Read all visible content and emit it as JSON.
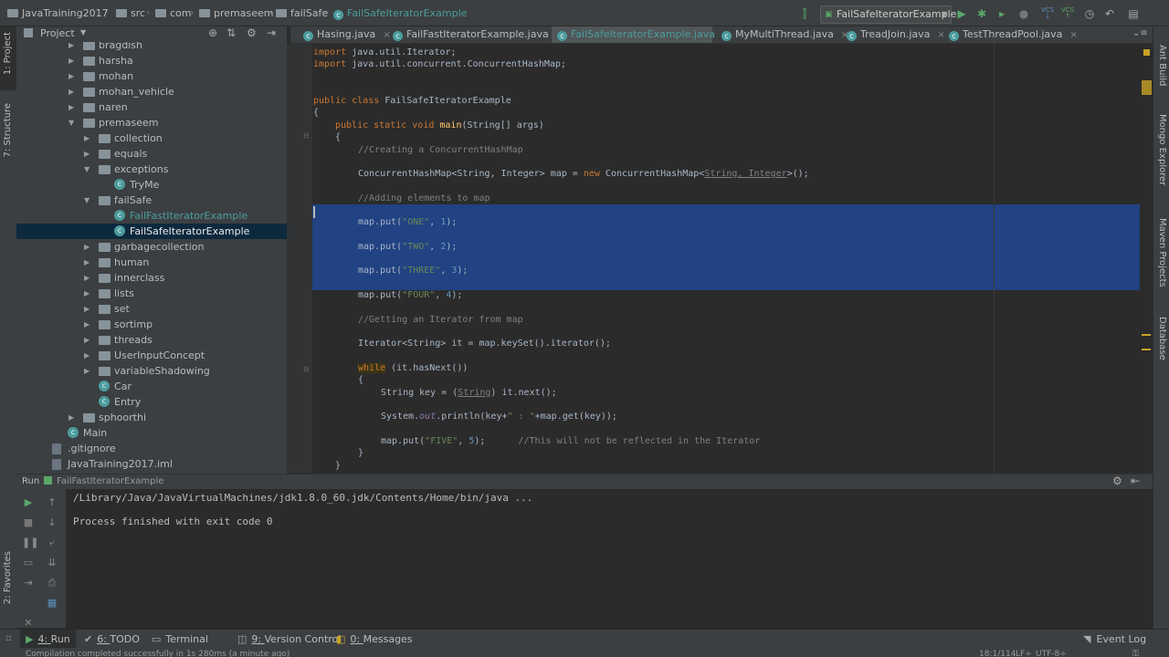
{
  "navbar": {
    "crumbs": [
      "JavaTraining2017",
      "src",
      "com",
      "premaseem",
      "failSafe",
      "FailSafeIteratorExample"
    ],
    "run_config": "FailSafeIteratorExample"
  },
  "tool_stripes": {
    "left": [
      "1: Project",
      "7: Structure",
      "2: Favorites"
    ],
    "right": [
      "Ant Build",
      "Mongo Explorer",
      "Maven Projects",
      "Database"
    ]
  },
  "project": {
    "header": "Project",
    "tree": [
      {
        "label": "bragdish",
        "kind": "folder",
        "level": 3,
        "arrow": "right"
      },
      {
        "label": "harsha",
        "kind": "folder",
        "level": 3,
        "arrow": "right"
      },
      {
        "label": "mohan",
        "kind": "folder",
        "level": 3,
        "arrow": "right"
      },
      {
        "label": "mohan_vehicle",
        "kind": "folder",
        "level": 3,
        "arrow": "right"
      },
      {
        "label": "naren",
        "kind": "folder",
        "level": 3,
        "arrow": "right"
      },
      {
        "label": "premaseem",
        "kind": "folder",
        "level": 3,
        "arrow": "down"
      },
      {
        "label": "collection",
        "kind": "folder",
        "level": 4,
        "arrow": "right"
      },
      {
        "label": "equals",
        "kind": "folder",
        "level": 4,
        "arrow": "right"
      },
      {
        "label": "exceptions",
        "kind": "folder",
        "level": 4,
        "arrow": "down"
      },
      {
        "label": "TryMe",
        "kind": "class",
        "level": 5,
        "arrow": ""
      },
      {
        "label": "failSafe",
        "kind": "folder",
        "level": 4,
        "arrow": "down"
      },
      {
        "label": "FailFastIteratorExample",
        "kind": "class",
        "level": 5,
        "arrow": "",
        "highlight": true
      },
      {
        "label": "FailSafeIteratorExample",
        "kind": "class",
        "level": 5,
        "arrow": "",
        "selected": true
      },
      {
        "label": "garbagecollection",
        "kind": "folder",
        "level": 4,
        "arrow": "right"
      },
      {
        "label": "human",
        "kind": "folder",
        "level": 4,
        "arrow": "right"
      },
      {
        "label": "innerclass",
        "kind": "folder",
        "level": 4,
        "arrow": "right"
      },
      {
        "label": "lists",
        "kind": "folder",
        "level": 4,
        "arrow": "right"
      },
      {
        "label": "set",
        "kind": "folder",
        "level": 4,
        "arrow": "right"
      },
      {
        "label": "sortimp",
        "kind": "folder",
        "level": 4,
        "arrow": "right"
      },
      {
        "label": "threads",
        "kind": "folder",
        "level": 4,
        "arrow": "right"
      },
      {
        "label": "UserInputConcept",
        "kind": "folder",
        "level": 4,
        "arrow": "right"
      },
      {
        "label": "variableShadowing",
        "kind": "folder",
        "level": 4,
        "arrow": "right"
      },
      {
        "label": "Car",
        "kind": "class",
        "level": 4,
        "arrow": ""
      },
      {
        "label": "Entry",
        "kind": "class",
        "level": 4,
        "arrow": ""
      },
      {
        "label": "sphoorthi",
        "kind": "folder",
        "level": 3,
        "arrow": "right"
      },
      {
        "label": "Main",
        "kind": "class",
        "level": 2,
        "arrow": ""
      },
      {
        "label": ".gitignore",
        "kind": "file",
        "level": 1,
        "arrow": ""
      },
      {
        "label": "JavaTraining2017.iml",
        "kind": "file",
        "level": 1,
        "arrow": ""
      }
    ]
  },
  "tabs": [
    {
      "label": "Hasing.java",
      "active": false
    },
    {
      "label": "FailFastIteratorExample.java",
      "active": false
    },
    {
      "label": "FailSafeIteratorExample.java",
      "active": true
    },
    {
      "label": "MyMultiThread.java",
      "active": false
    },
    {
      "label": "TreadJoin.java",
      "active": false
    },
    {
      "label": "TestThreadPool.java",
      "active": false
    }
  ],
  "code": {
    "import1_kw": "import",
    "import1": " java.util.Iterator;",
    "import2_kw": "import",
    "import2": " java.util.concurrent.ConcurrentHashMap;",
    "class_kw": "public class",
    "class_name": " FailSafeIteratorExample",
    "brace_open": "{",
    "main_kw": "public static void",
    "main_name": " main",
    "main_args": "(String[] args)",
    "inner_brace": "{",
    "comment_create": "//Creating a ConcurrentHashMap",
    "map_decl_a": "ConcurrentHashMap<String, Integer> map = ",
    "map_decl_new": "new",
    "map_decl_b": " ConcurrentHashMap<",
    "map_decl_c": "String, Integer",
    "map_decl_d": ">();",
    "comment_add": "//Adding elements to map",
    "puts": [
      {
        "pre": "map.put(",
        "key": "\"ONE\"",
        "mid": ", ",
        "val": "1",
        "post": ");"
      },
      {
        "pre": "map.put(",
        "key": "\"TWO\"",
        "mid": ", ",
        "val": "2",
        "post": ");"
      },
      {
        "pre": "map.put(",
        "key": "\"THREE\"",
        "mid": ", ",
        "val": "3",
        "post": ");"
      },
      {
        "pre": "map.put(",
        "key": "\"FOUR\"",
        "mid": ", ",
        "val": "4",
        "post": ");"
      }
    ],
    "comment_get": "//Getting an Iterator from map",
    "iter_decl": "Iterator<String> it = map.keySet().iterator();",
    "while_kw": "while",
    "while_cond": " (it.hasNext())",
    "loop_brace": "{",
    "key_a": "String key = (",
    "key_cast": "String",
    "key_b": ") it.next();",
    "print_a": "System.",
    "print_out": "out",
    "print_b": ".println(key+",
    "print_str": "\" : \"",
    "print_c": "+map.get(key));",
    "five_pre": "map.put(",
    "five_key": "\"FIVE\"",
    "five_mid": ", ",
    "five_val": "5",
    "five_post": ");",
    "five_comment": "//This will not be reflected in the Iterator",
    "loop_close": "}",
    "method_close": "}"
  },
  "run": {
    "header_label": "Run",
    "config": "FailFastIteratorExample",
    "console_cmd": "/Library/Java/JavaVirtualMachines/jdk1.8.0_60.jdk/Contents/Home/bin/java ...",
    "console_exit": "Process finished with exit code 0"
  },
  "bottom_tabs": [
    {
      "num": "4",
      "label": "Run",
      "active": true
    },
    {
      "num": "6",
      "label": "TODO",
      "active": false
    },
    {
      "num": "",
      "label": "Terminal",
      "active": false
    },
    {
      "num": "9",
      "label": "Version Control",
      "active": false
    },
    {
      "num": "0",
      "label": "Messages",
      "active": false
    }
  ],
  "event_log": "Event Log",
  "status": {
    "message": "Compilation completed successfully in 1s 280ms (a minute ago)",
    "position": "18:1/114",
    "line_sep": "LF÷",
    "encoding": "UTF-8÷"
  },
  "colors": {
    "accent": "#214283",
    "keyword": "#cc7832",
    "string": "#6a8759",
    "number": "#6897bb",
    "comment": "#808080",
    "run_green": "#59a869"
  }
}
